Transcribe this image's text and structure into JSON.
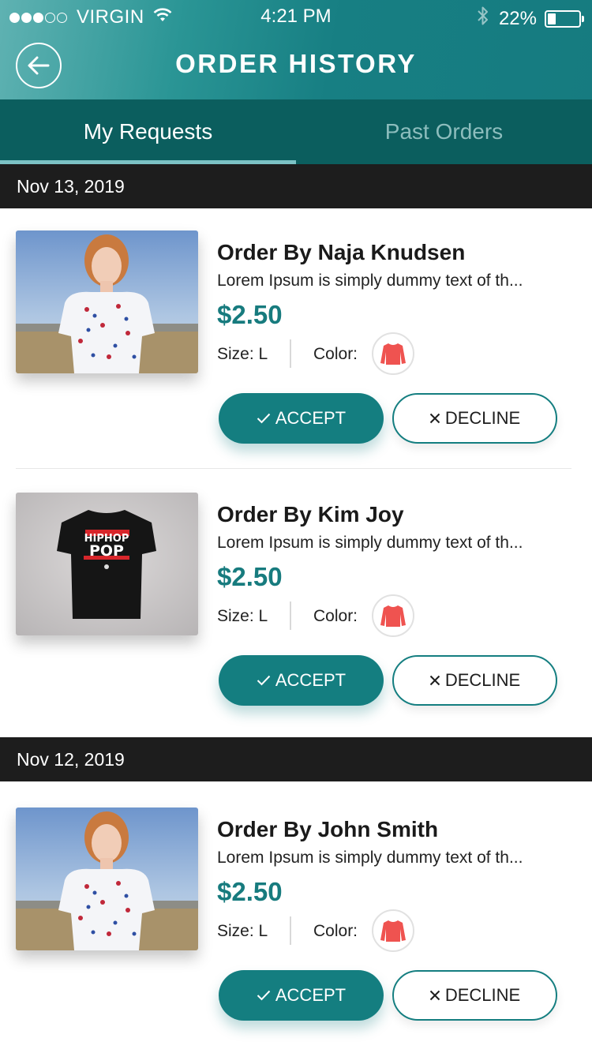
{
  "status_bar": {
    "carrier": "VIRGIN",
    "time": "4:21 PM",
    "battery": "22%",
    "battery_level": 0.22,
    "signal_bars_filled": 3,
    "signal_bars_total": 5
  },
  "header": {
    "title": "ORDER HISTORY",
    "back_icon": "back-arrow-icon"
  },
  "tabs": [
    {
      "label": "My Requests",
      "active": true
    },
    {
      "label": "Past Orders",
      "active": false
    }
  ],
  "groups": [
    {
      "date": "Nov 13, 2019",
      "orders": [
        {
          "title": "Order By Naja Knudsen",
          "description": "Lorem Ipsum is simply dummy text of th...",
          "price": "$2.50",
          "size": "Size: L",
          "color_label": "Color:",
          "accept": "ACCEPT",
          "decline": "DECLINE"
        },
        {
          "title": "Order By Kim Joy",
          "description": "Lorem Ipsum is simply dummy text of th...",
          "price": "$2.50",
          "size": "Size: L",
          "color_label": "Color:",
          "accept": "ACCEPT",
          "decline": "DECLINE",
          "shirt_text_1": "HIPHOP",
          "shirt_text_2": "POP"
        }
      ]
    },
    {
      "date": "Nov 12, 2019",
      "orders": [
        {
          "title": "Order By John Smith",
          "description": "Lorem Ipsum is simply dummy text of th...",
          "price": "$2.50",
          "size": "Size: L",
          "color_label": "Color:",
          "accept": "ACCEPT",
          "decline": "DECLINE"
        }
      ]
    }
  ],
  "colors": {
    "accent": "#147e80",
    "tab_bar": "#0b5e5e",
    "date_bar": "#1d1d1d",
    "swatch": "#ef5350"
  }
}
